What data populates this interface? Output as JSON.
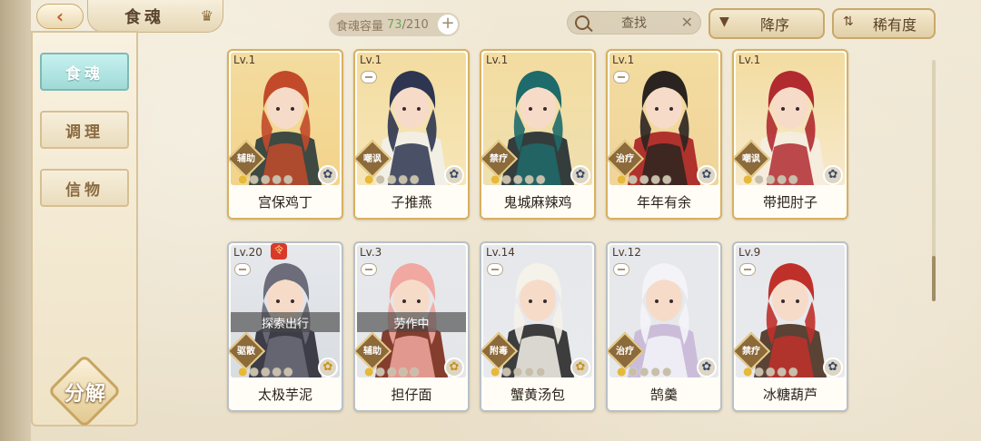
{
  "header": {
    "back_icon": "back-arrow-icon",
    "title": "食魂",
    "capacity_label": "食魂容量",
    "capacity_current": "73",
    "capacity_total": "/210",
    "capacity_add": "+",
    "search_placeholder": "查找",
    "search_clear": "✕",
    "sort_order_label": "降序",
    "sort_order_icon": "▼",
    "sort_field_label": "稀有度",
    "sort_field_icon": "⇅"
  },
  "sidebar": {
    "items": [
      {
        "label": "食魂",
        "active": true
      },
      {
        "label": "调理",
        "active": false
      },
      {
        "label": "信物",
        "active": false
      }
    ],
    "decompose_label": "分解"
  },
  "colors": {
    "gold_border": "#d8b060",
    "silver_border": "#b9c0c8",
    "active_tab": "#9fdad7"
  },
  "cards": [
    {
      "level": "Lv.1",
      "role": "辅助",
      "name": "宫保鸡丁",
      "stars": 5,
      "lit": 1,
      "rarity": "gold",
      "element": "flower-icon",
      "palette": [
        "#f3d38a",
        "#c24a2a",
        "#2a3a3a"
      ]
    },
    {
      "level": "Lv.1",
      "role": "嘲讽",
      "name": "子推燕",
      "stars": 5,
      "lit": 1,
      "rarity": "gold",
      "element": "flower-icon",
      "palette": [
        "#f6e6b8",
        "#2d3550",
        "#f2f0ea"
      ]
    },
    {
      "level": "Lv.1",
      "role": "禁疗",
      "name": "鬼城麻辣鸡",
      "stars": 5,
      "lit": 1,
      "rarity": "gold",
      "element": "flower-icon",
      "palette": [
        "#efe0b0",
        "#1f6a6a",
        "#202a30"
      ]
    },
    {
      "level": "Lv.1",
      "role": "治疗",
      "name": "年年有余",
      "stars": 5,
      "lit": 1,
      "rarity": "gold",
      "element": "flower-icon",
      "palette": [
        "#f0d49a",
        "#2a2420",
        "#a82020"
      ]
    },
    {
      "level": "Lv.1",
      "role": "嘲讽",
      "name": "带把肘子",
      "stars": 5,
      "lit": 1,
      "rarity": "gold",
      "element": "flower-icon",
      "palette": [
        "#f7e9cc",
        "#b02a30",
        "#f5ede0"
      ]
    },
    {
      "level": "Lv.20",
      "role": "驱散",
      "name": "太极芋泥",
      "stars": 5,
      "lit": 1,
      "rarity": "silver",
      "element": "gold-flower-icon",
      "status": "探索出行",
      "badge": "令",
      "palette": [
        "#d8dde2",
        "#6c6c7a",
        "#2b2b35"
      ]
    },
    {
      "level": "Lv.3",
      "role": "辅助",
      "name": "担仔面",
      "stars": 5,
      "lit": 1,
      "rarity": "silver",
      "element": "gold-flower-icon",
      "status": "劳作中",
      "palette": [
        "#e4e6ea",
        "#f0a8a0",
        "#7a2a1a"
      ]
    },
    {
      "level": "Lv.14",
      "role": "附毒",
      "name": "蟹黄汤包",
      "stars": 5,
      "lit": 1,
      "rarity": "silver",
      "element": "gold-flower-icon",
      "palette": [
        "#e8eaee",
        "#f5f2ea",
        "#2a2a2a"
      ]
    },
    {
      "level": "Lv.12",
      "role": "治疗",
      "name": "鹄羹",
      "stars": 5,
      "lit": 1,
      "rarity": "silver",
      "element": "flower-icon",
      "palette": [
        "#e6e8ec",
        "#f4f4f8",
        "#c8b8d8"
      ]
    },
    {
      "level": "Lv.9",
      "role": "禁疗",
      "name": "冰糖葫芦",
      "stars": 5,
      "lit": 1,
      "rarity": "silver",
      "element": "flower-icon",
      "palette": [
        "#e8eaee",
        "#c0302a",
        "#4a3020"
      ]
    }
  ]
}
